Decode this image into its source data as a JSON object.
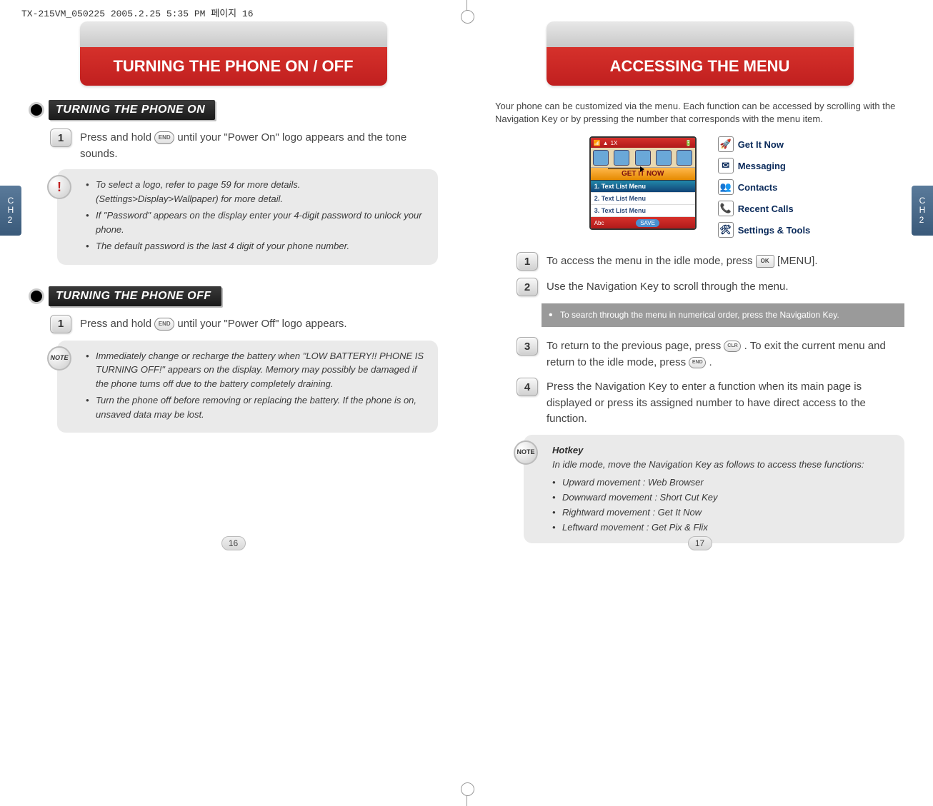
{
  "doc_header": "TX-215VM_050225  2005.2.25 5:35 PM  페이지 16",
  "left": {
    "title": "TURNING THE PHONE ON / OFF",
    "chapter": "CH\n2",
    "section_on": "TURNING THE PHONE ON",
    "step_on_1": "Press and hold        until your \"Power On\" logo appears and the tone sounds.",
    "callout_on": {
      "items": [
        "To select a logo, refer to page 59 for more details. (Settings>Display>Wallpaper) for more detail.",
        "If \"Password\" appears on the display enter your 4-digit password to unlock your phone.",
        "The default password is the last 4 digit of your  phone number."
      ]
    },
    "section_off": "TURNING THE PHONE OFF",
    "step_off_1": "Press and hold        until your \"Power Off\" logo appears.",
    "callout_off": {
      "items": [
        "Immediately change or recharge the battery when \"LOW BATTERY!! PHONE IS TURNING OFF!\" appears on the display. Memory may possibly be damaged if the phone turns off due to the battery completely draining.",
        "Turn the phone off before removing or replacing the battery. If the phone is on, unsaved data may be lost."
      ]
    },
    "page_number": "16"
  },
  "right": {
    "title": "ACCESSING THE MENU",
    "chapter": "CH\n2",
    "intro": "Your phone can be customized via the menu. Each function can be accessed by scrolling with the Navigation Key or by pressing the number that corresponds with the menu item.",
    "phone": {
      "tab": "GET IT NOW",
      "list": [
        "1. Text List Menu",
        "2. Text List Menu",
        "3. Text List Menu"
      ],
      "bottom_left": "Abc",
      "bottom_save": "SAVE"
    },
    "menu_items": [
      {
        "icon": "🚀",
        "label": "Get It Now"
      },
      {
        "icon": "✉",
        "label": "Messaging"
      },
      {
        "icon": "👥",
        "label": "Contacts"
      },
      {
        "icon": "📞",
        "label": "Recent Calls"
      },
      {
        "icon": "🛠",
        "label": "Settings & Tools"
      }
    ],
    "step1": "To access the menu in the idle mode, press       [MENU].",
    "step2": "Use the Navigation Key to scroll through the menu.",
    "tip2": "To search through the menu in numerical order, press the Navigation Key.",
    "step3": "To return to the previous page, press       . To exit the current menu and return to the idle mode, press        .",
    "step4": "Press the Navigation Key to enter a function when its main page is displayed or press its assigned number to have direct access to the function.",
    "hotkey": {
      "title": "Hotkey",
      "intro": "In idle mode, move the Navigation Key as follows to access these functions:",
      "items": [
        "Upward movement : Web Browser",
        "Downward movement : Short Cut Key",
        "Rightward movement : Get It Now",
        "Leftward movement : Get Pix & Flix"
      ]
    },
    "page_number": "17"
  },
  "badges": {
    "alert": "!",
    "note": "NOTE"
  },
  "keys": {
    "end": "END",
    "ok": "OK",
    "clr": "CLR"
  }
}
